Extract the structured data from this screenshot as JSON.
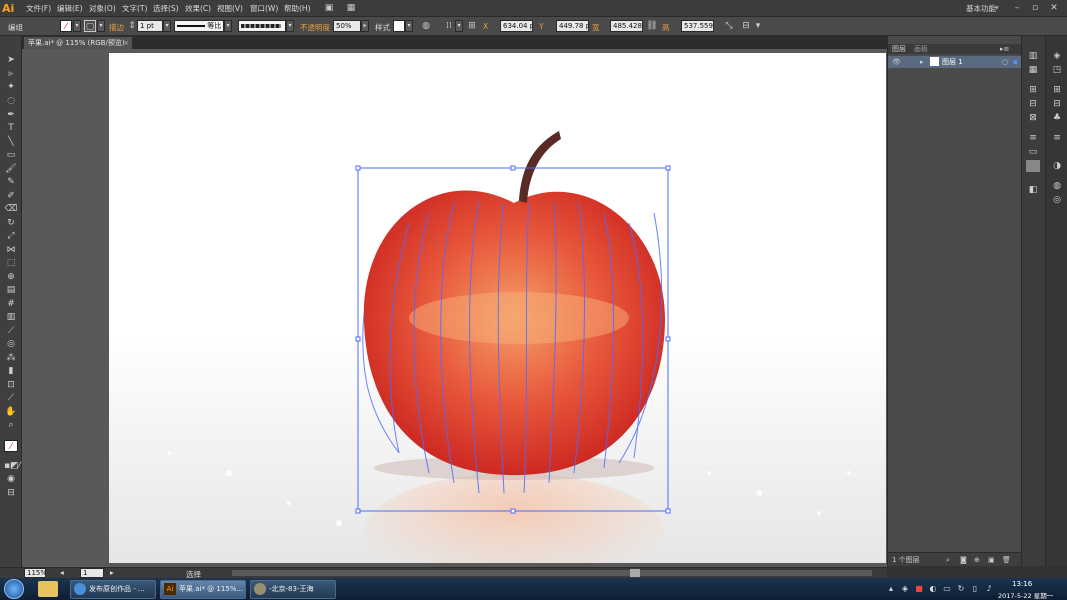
{
  "app": {
    "logo": "Ai"
  },
  "menu": {
    "items": [
      "文件(F)",
      "编辑(E)",
      "对象(O)",
      "文字(T)",
      "选择(S)",
      "效果(C)",
      "视图(V)",
      "窗口(W)",
      "帮助(H)"
    ],
    "workspace": "基本功能"
  },
  "control_bar": {
    "selection_label": "编组",
    "stroke_label": "描边",
    "stroke_weight": "1 pt",
    "brush_label": "等比",
    "opacity_label": "不透明度",
    "opacity_value": "50%",
    "style_label": "样式",
    "x_value": "634.04 p",
    "y_value": "449.78 p",
    "width_label": "宽",
    "width_value": "485.428",
    "height_label": "高",
    "height_value": "537.559"
  },
  "document": {
    "tab_title": "苹果.ai* @ 115% (RGB/预览)",
    "tab_close": "×"
  },
  "layers_panel": {
    "tabs": [
      "图层",
      "画板"
    ],
    "layer_name": "图层 1",
    "footer_count": "1 个图层"
  },
  "status_bar": {
    "zoom": "115%",
    "artboard_num": "1",
    "tool_status": "选择"
  },
  "taskbar": {
    "buttons": [
      "发布原创作品 - ...",
      "苹果.ai* @ 115%...",
      "-北京-83-王海"
    ],
    "time": "13:16",
    "date": "2017-5-22 星期一"
  },
  "colors": {
    "accent_orange": "#f7a31c",
    "selection_blue": "#4d6bff",
    "apple_red": "#e03a30"
  }
}
